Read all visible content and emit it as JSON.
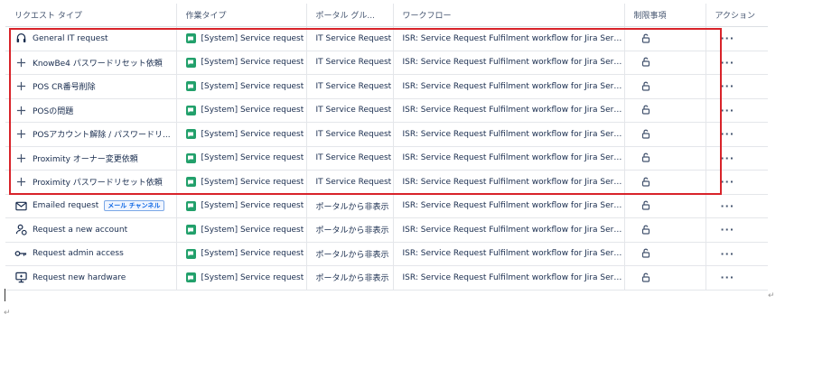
{
  "columns": [
    "リクエスト タイプ",
    "作業タイプ",
    "ポータル グル...",
    "ワークフロー",
    "制限事項",
    "アクション"
  ],
  "rows": [
    {
      "icon": "headset-icon",
      "name": "General IT request",
      "badge": "",
      "work_type": "[System] Service request",
      "portal_group": "IT Service Request",
      "workflow": "ISR: Service Request Fulfilment workflow for Jira Service ...",
      "action": "···"
    },
    {
      "icon": "plus-icon",
      "name": "KnowBe4 パスワードリセット依頼",
      "badge": "",
      "work_type": "[System] Service request",
      "portal_group": "IT Service Request",
      "workflow": "ISR: Service Request Fulfilment workflow for Jira Service ...",
      "action": "···"
    },
    {
      "icon": "plus-icon",
      "name": "POS CR番号削除",
      "badge": "",
      "work_type": "[System] Service request",
      "portal_group": "IT Service Request",
      "workflow": "ISR: Service Request Fulfilment workflow for Jira Service ...",
      "action": "···"
    },
    {
      "icon": "plus-icon",
      "name": "POSの問題",
      "badge": "",
      "work_type": "[System] Service request",
      "portal_group": "IT Service Request",
      "workflow": "ISR: Service Request Fulfilment workflow for Jira Service ...",
      "action": "···"
    },
    {
      "icon": "plus-icon",
      "name": "POSアカウント解除 / パスワードリ...",
      "badge": "",
      "work_type": "[System] Service request",
      "portal_group": "IT Service Request",
      "workflow": "ISR: Service Request Fulfilment workflow for Jira Service ...",
      "action": "···"
    },
    {
      "icon": "plus-icon",
      "name": "Proximity オーナー変更依頼",
      "badge": "",
      "work_type": "[System] Service request",
      "portal_group": "IT Service Request",
      "workflow": "ISR: Service Request Fulfilment workflow for Jira Service ...",
      "action": "···"
    },
    {
      "icon": "plus-icon",
      "name": "Proximity パスワードリセット依頼",
      "badge": "",
      "work_type": "[System] Service request",
      "portal_group": "IT Service Request",
      "workflow": "ISR: Service Request Fulfilment workflow for Jira Service ...",
      "action": "···"
    },
    {
      "icon": "envelope-icon",
      "name": "Emailed request",
      "badge": "メール チャンネル",
      "work_type": "[System] Service request",
      "portal_group": "ポータルから非表示",
      "workflow": "ISR: Service Request Fulfilment workflow for Jira Service ...",
      "action": "···"
    },
    {
      "icon": "add-user-icon",
      "name": "Request a new account",
      "badge": "",
      "work_type": "[System] Service request",
      "portal_group": "ポータルから非表示",
      "workflow": "ISR: Service Request Fulfilment workflow for Jira Service ...",
      "action": "···"
    },
    {
      "icon": "key-icon",
      "name": "Request admin access",
      "badge": "",
      "work_type": "[System] Service request",
      "portal_group": "ポータルから非表示",
      "workflow": "ISR: Service Request Fulfilment workflow for Jira Service ...",
      "action": "···"
    },
    {
      "icon": "monitor-icon",
      "name": "Request new hardware",
      "badge": "",
      "work_type": "[System] Service request",
      "portal_group": "ポータルから非表示",
      "workflow": "ISR: Service Request Fulfilment workflow for Jira Service ...",
      "action": "···"
    }
  ],
  "paragraph_mark": "↵",
  "colors": {
    "highlight": "#d8232a",
    "work_type_icon": "#22a06b"
  }
}
